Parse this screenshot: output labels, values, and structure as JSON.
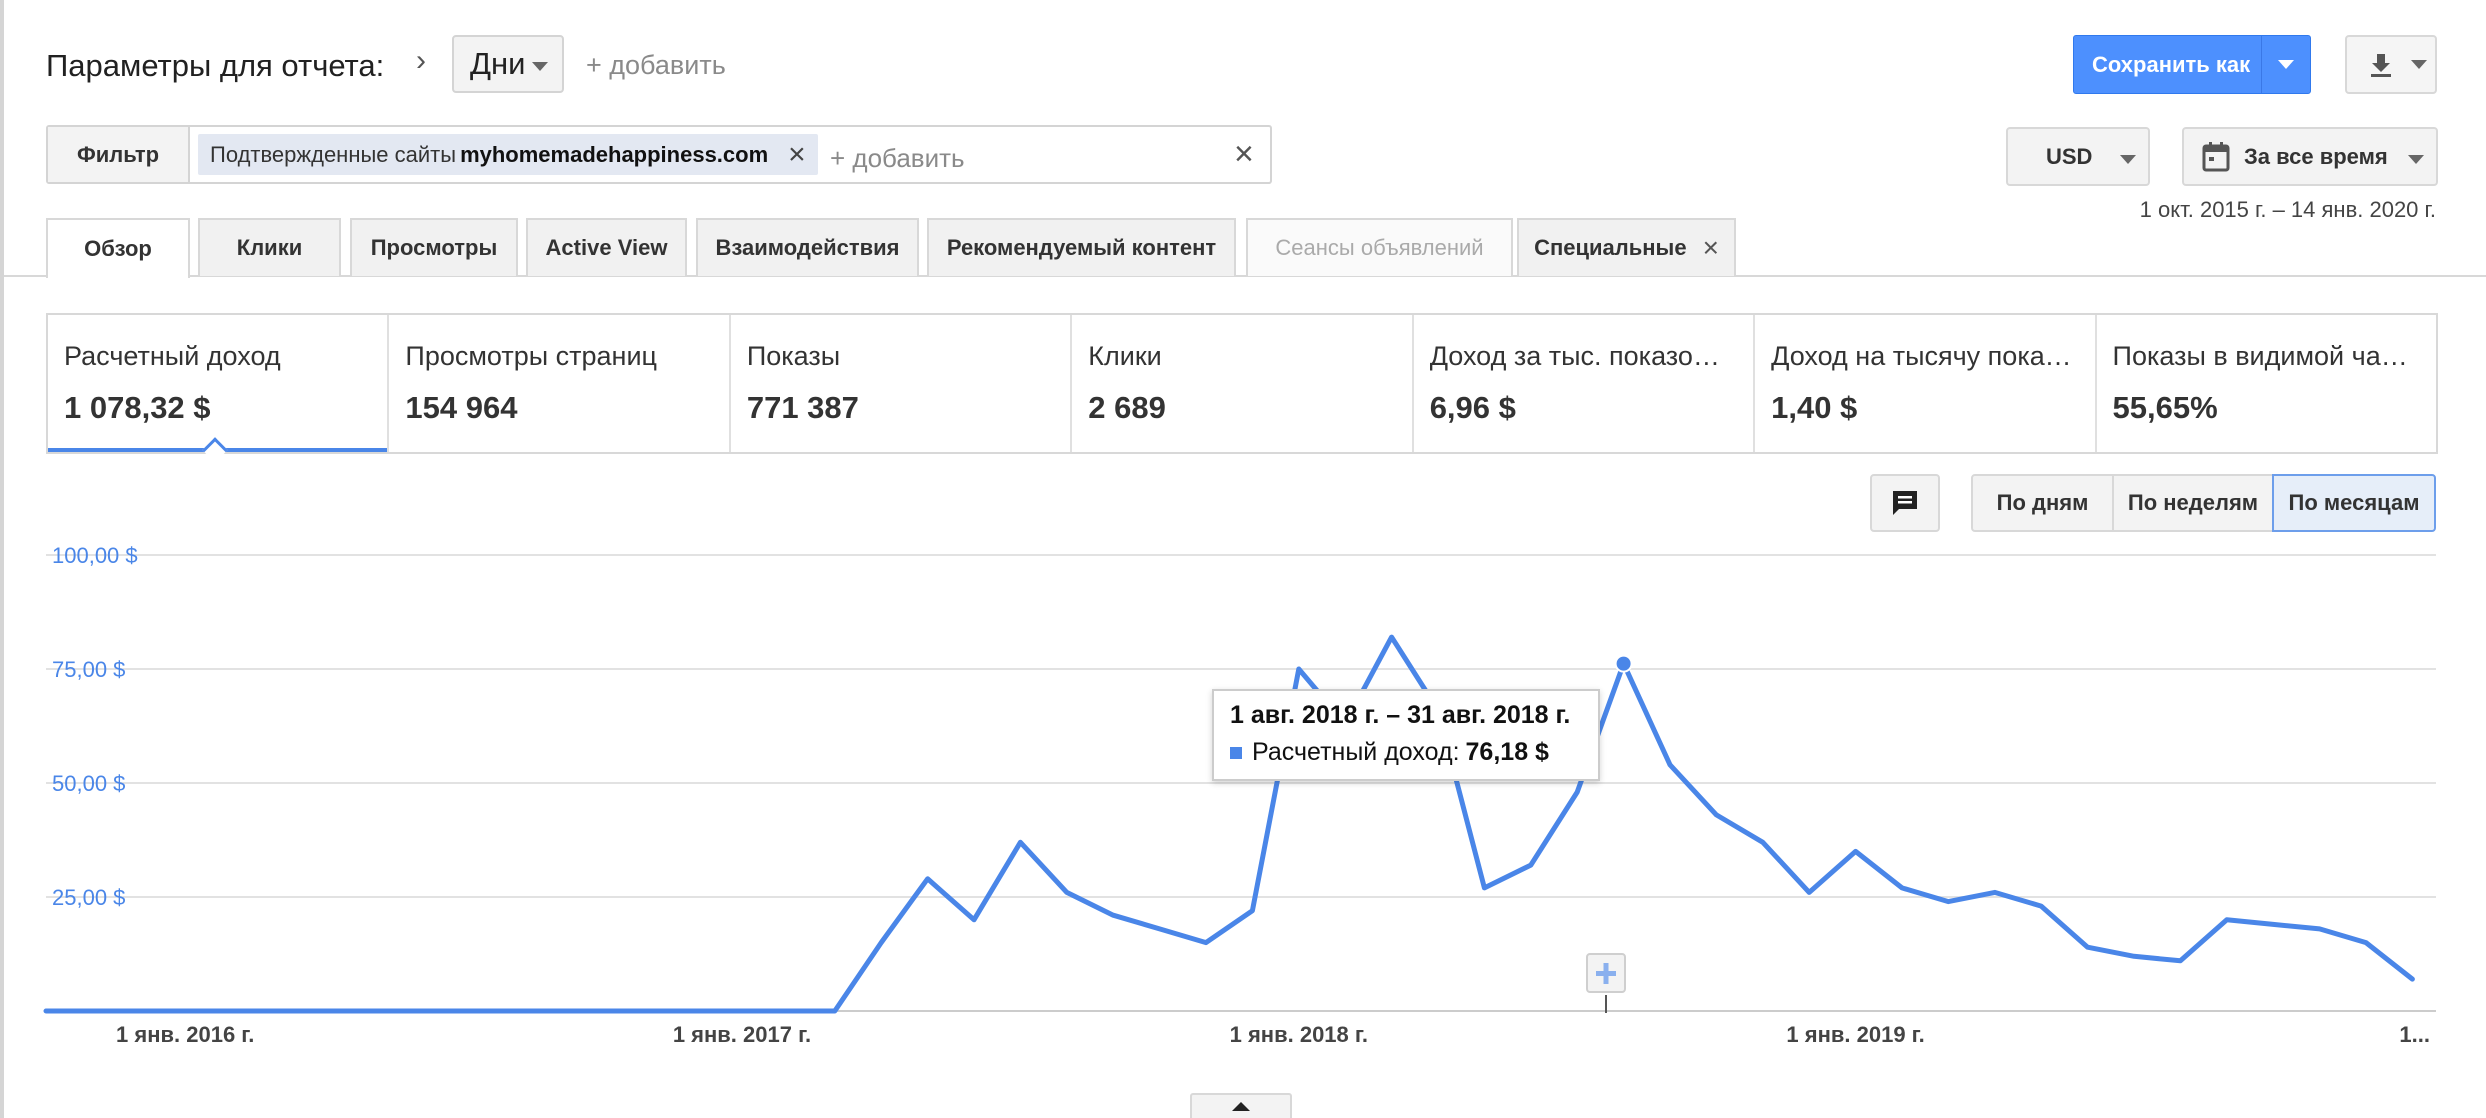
{
  "header": {
    "title": "Параметры для отчета:",
    "chevron": "›",
    "dimension": "Дни",
    "add_dimension": "+ добавить",
    "save_label": "Сохранить как"
  },
  "filter": {
    "label": "Фильтр",
    "chip_prefix": "Подтвержденные сайты",
    "chip_value": "myhomemadehappiness.com",
    "add_placeholder": "+ добавить"
  },
  "currency": "USD",
  "date_preset": "За все время",
  "date_range": "1 окт. 2015 г. – 14 янв. 2020 г.",
  "tabs": [
    {
      "label": "Обзор"
    },
    {
      "label": "Клики"
    },
    {
      "label": "Просмотры"
    },
    {
      "label": "Active View"
    },
    {
      "label": "Взаимодействия"
    },
    {
      "label": "Рекомендуемый контент"
    },
    {
      "label": "Сеансы объявлений"
    },
    {
      "label": "Специальные"
    }
  ],
  "metrics": [
    {
      "name": "Расчетный доход",
      "value": "1 078,32 $"
    },
    {
      "name": "Просмотры страниц",
      "value": "154 964"
    },
    {
      "name": "Показы",
      "value": "771 387"
    },
    {
      "name": "Клики",
      "value": "2 689"
    },
    {
      "name": "Доход за тыс. показов ...",
      "value": "6,96 $"
    },
    {
      "name": "Доход на тысячу показ...",
      "value": "1,40 $"
    },
    {
      "name": "Показы в видимой час...",
      "value": "55,65%"
    }
  ],
  "granularity": [
    "По дням",
    "По неделям",
    "По месяцам"
  ],
  "granularity_selected": "По месяцам",
  "colors": {
    "accent": "#4a86e8",
    "save_button": "#4d90fe"
  },
  "icons": [
    "chevron-right-icon",
    "caret-down-icon",
    "download-icon",
    "close-icon",
    "calendar-icon",
    "comment-icon",
    "plus-icon",
    "caret-up-icon"
  ],
  "tooltip": {
    "title": "1 авг. 2018 г. – 31 авг. 2018 г.",
    "series_label": "Расчетный доход:",
    "value": "76,18 $"
  },
  "chart_data": {
    "type": "line",
    "y_tick_labels": [
      "100,00 $",
      "75,00 $",
      "50,00 $",
      "25,00 $"
    ],
    "y_ticks": [
      100,
      75,
      50,
      25
    ],
    "ylim": [
      0,
      100
    ],
    "x_tick_labels": [
      "1 янв. 2016 г.",
      "1 янв. 2017 г.",
      "1 янв. 2018 г.",
      "1 янв. 2019 г.",
      "1..."
    ],
    "x_tick_values": [
      "2016-01",
      "2017-01",
      "2018-01",
      "2019-01",
      "2020-01"
    ],
    "grid": true,
    "series": [
      {
        "name": "Расчетный доход",
        "x": [
          "2015-10",
          "2015-11",
          "2015-12",
          "2016-01",
          "2016-02",
          "2016-03",
          "2016-04",
          "2016-05",
          "2016-06",
          "2016-07",
          "2016-08",
          "2016-09",
          "2016-10",
          "2016-11",
          "2016-12",
          "2017-01",
          "2017-02",
          "2017-03",
          "2017-04",
          "2017-05",
          "2017-06",
          "2017-07",
          "2017-08",
          "2017-09",
          "2017-10",
          "2017-11",
          "2017-12",
          "2018-01",
          "2018-02",
          "2018-03",
          "2018-04",
          "2018-05",
          "2018-06",
          "2018-07",
          "2018-08",
          "2018-09",
          "2018-10",
          "2018-11",
          "2018-12",
          "2019-01",
          "2019-02",
          "2019-03",
          "2019-04",
          "2019-05",
          "2019-06",
          "2019-07",
          "2019-08",
          "2019-09",
          "2019-10",
          "2019-11",
          "2019-12",
          "2020-01"
        ],
        "values": [
          0,
          0,
          0,
          0,
          0,
          0,
          0,
          0,
          0,
          0,
          0,
          0,
          0,
          0,
          0,
          0,
          0,
          0,
          15,
          29,
          20,
          37,
          26,
          21,
          18,
          15,
          22,
          75,
          63,
          82,
          66,
          27,
          32,
          48,
          76.18,
          54,
          43,
          37,
          26,
          35,
          27,
          24,
          26,
          23,
          14,
          12,
          11,
          20,
          19,
          18,
          15,
          7
        ]
      }
    ],
    "highlight_x": "2018-08"
  }
}
